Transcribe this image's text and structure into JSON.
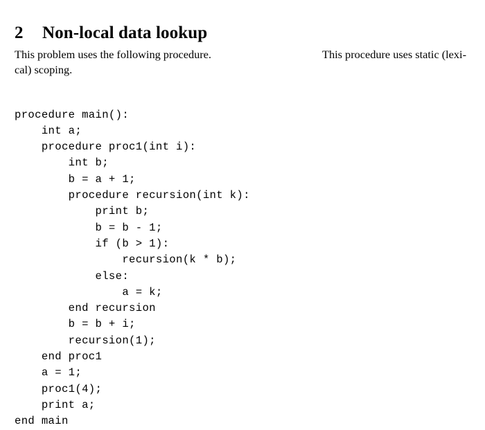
{
  "document": {
    "heading": {
      "number": "2",
      "title": "Non-local data lookup"
    },
    "paragraph": {
      "line1_a": "This problem uses the following procedure.",
      "line1_b": "This procedure uses static (lexi-",
      "line2": "cal) scoping.",
      "full_text": "This problem uses the following procedure. This procedure uses static (lexical) scoping."
    },
    "code": {
      "language": "pseudocode",
      "lines": [
        "procedure main():",
        "    int a;",
        "    procedure proc1(int i):",
        "        int b;",
        "        b = a + 1;",
        "        procedure recursion(int k):",
        "            print b;",
        "            b = b - 1;",
        "            if (b > 1):",
        "                recursion(k * b);",
        "            else:",
        "                a = k;",
        "        end recursion",
        "        b = b + i;",
        "        recursion(1);",
        "    end proc1",
        "    a = 1;",
        "    proc1(4);",
        "    print a;",
        "end main"
      ]
    }
  },
  "colors": {
    "page_background": "#ffffff",
    "text": "#000000"
  }
}
